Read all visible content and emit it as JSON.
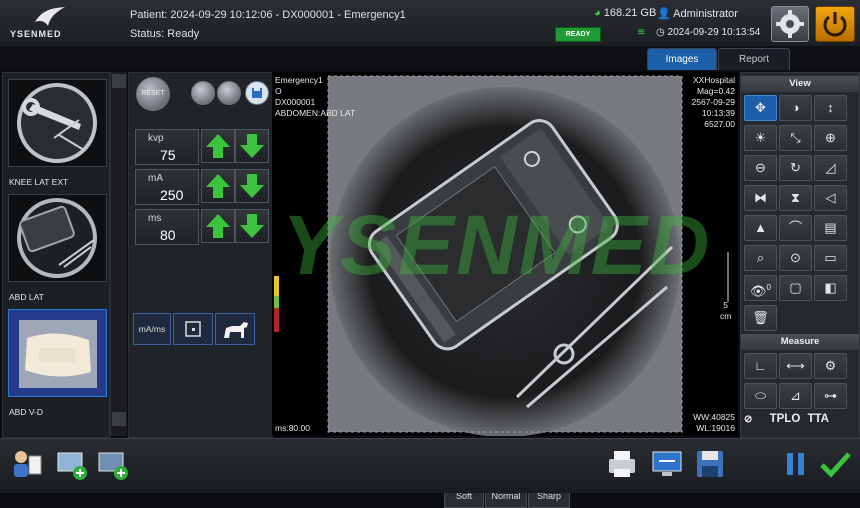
{
  "brand": {
    "logo_text": "YSENMED",
    "watermark": "YSENMED"
  },
  "header": {
    "patient": "Patient: 2024-09-29 10:12:06 - DX000001 - Emergency1",
    "status": "Status: Ready",
    "ready_badge": "READY",
    "disk": "168.21 GB",
    "user": "Administrator",
    "datetime": "2024-09-29 10:13:54"
  },
  "tabs": {
    "images": "Images",
    "report": "Report"
  },
  "thumbnails": [
    {
      "label": "KNEE LAT EXT"
    },
    {
      "label": "ABD LAT"
    },
    {
      "label": "ABD V-D"
    }
  ],
  "controls": {
    "reset_label": "RESET",
    "params": [
      {
        "label": "kvp",
        "value": "75"
      },
      {
        "label": "mA",
        "value": "250"
      },
      {
        "label": "ms",
        "value": "80"
      }
    ],
    "mode_label": "mA/ms"
  },
  "viewer": {
    "top_left": [
      "Emergency1",
      "O",
      "DX000001",
      "ABDOMEN:ABD LAT"
    ],
    "top_right": [
      "XXHospital",
      "Mag=0.42",
      "2567-09-29",
      "10:13:39",
      "6527.00"
    ],
    "scale_value": "5",
    "scale_unit": "cm",
    "bottom_left": "ms:80.00",
    "ww": "WW:40825",
    "wl": "WL:19016",
    "processing": [
      "Soft",
      "Normal",
      "Sharp"
    ]
  },
  "tools": {
    "view_title": "View",
    "measure_title": "Measure",
    "tplo_label": "TPLO",
    "tta_label": "TTA",
    "eye_counter": "0"
  },
  "colors": {
    "accent": "#1c5fa8",
    "ready": "#1f9a35",
    "arrow": "#3cc43f",
    "power": "#f0a60d",
    "watermark": "#3fb53f"
  }
}
